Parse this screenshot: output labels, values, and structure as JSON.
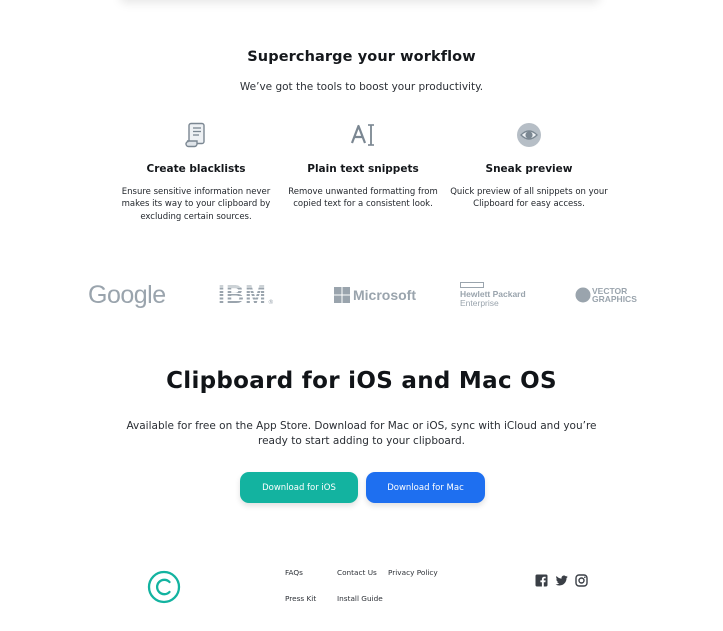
{
  "workflow": {
    "title": "Supercharge your workflow",
    "subtitle": "We’ve got the tools to boost your productivity.",
    "features": [
      {
        "icon": "blacklist-scroll-icon",
        "title": "Create blacklists",
        "description": "Ensure sensitive information never makes its way to your clipboard by excluding certain sources."
      },
      {
        "icon": "text-cursor-icon",
        "title": "Plain text snippets",
        "description": "Remove unwanted formatting from copied text for a consistent look."
      },
      {
        "icon": "eye-icon",
        "title": "Sneak preview",
        "description": "Quick preview of all snippets on your Clipboard for easy access."
      }
    ]
  },
  "partners": {
    "google": "Google",
    "ibm": "IBM",
    "microsoft": "Microsoft",
    "hpe_line1": "Hewlett Packard",
    "hpe_line2": "Enterprise",
    "vector_line1": "VECTOR",
    "vector_line2": "GRAPHICS"
  },
  "download": {
    "title": "Clipboard for iOS and Mac OS",
    "description": "Available for free on the App Store. Download for Mac or iOS, sync with iCloud and you’re ready to start adding to your clipboard.",
    "ios_label": "Download for iOS",
    "mac_label": "Download for Mac"
  },
  "footer": {
    "logo_icon": "copyright-logo-icon",
    "links": [
      "FAQs",
      "Contact Us",
      "Privacy Policy",
      "Press Kit",
      "Install Guide"
    ],
    "social_icons": [
      "facebook-icon",
      "twitter-icon",
      "instagram-icon"
    ]
  },
  "colors": {
    "ios_button": "#13b3a0",
    "mac_button": "#1e6ff0",
    "brand_accent": "#13b3a0",
    "logo_gray": "#9aa4ad"
  }
}
